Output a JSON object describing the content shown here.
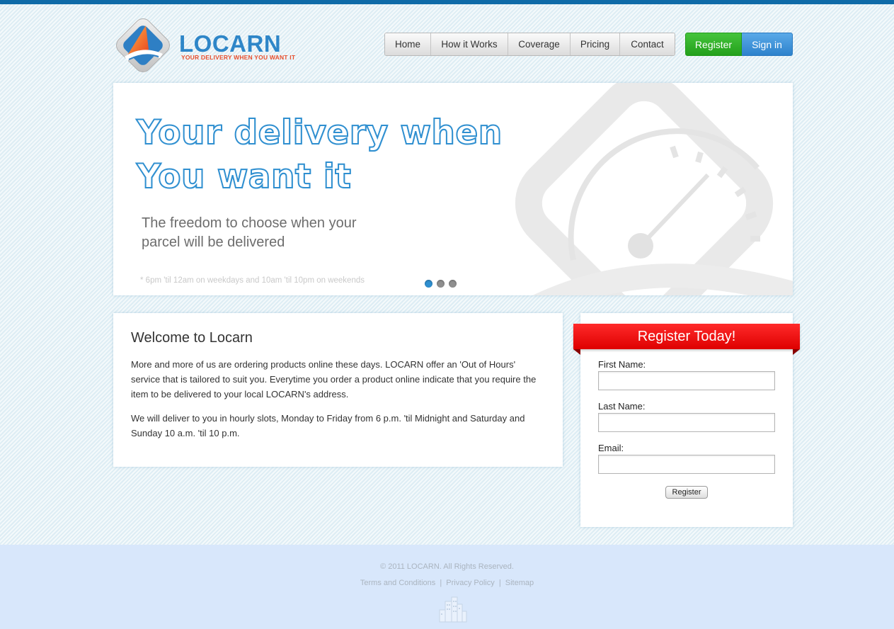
{
  "brand": {
    "name": "LOCARN",
    "tagline": "YOUR DELIVERY WHEN YOU WANT IT",
    "primary_color": "#2e86c8",
    "accent_color": "#e9502e"
  },
  "nav": {
    "items": [
      {
        "label": "Home"
      },
      {
        "label": "How it Works"
      },
      {
        "label": "Coverage"
      },
      {
        "label": "Pricing"
      },
      {
        "label": "Contact"
      }
    ]
  },
  "auth": {
    "register_label": "Register",
    "signin_label": "Sign in",
    "register_color": "#2fb127",
    "signin_color": "#3a8fd6"
  },
  "hero": {
    "title_line1": "Your delivery when",
    "title_line2": "You want it",
    "subtitle_line1": "The freedom to choose when your",
    "subtitle_line2": "parcel will be delivered",
    "note": "* 6pm 'til 12am on weekdays and 10am 'til 10pm on weekends",
    "slides": 3,
    "active_slide": 1
  },
  "welcome": {
    "heading": "Welcome to Locarn",
    "para1": "More and more of us are ordering products online these days. LOCARN offer an 'Out of Hours' service that is tailored to suit you. Everytime you order a product online indicate that you require the item to be delivered to your local LOCARN's address.",
    "para2": "We will deliver to you in hourly slots, Monday to Friday from 6 p.m. 'til Midnight and Saturday and Sunday 10 a.m. 'til 10 p.m."
  },
  "register_form": {
    "title": "Register Today!",
    "first_name_label": "First Name:",
    "first_name_value": "",
    "last_name_label": "Last Name:",
    "last_name_value": "",
    "email_label": "Email:",
    "email_value": "",
    "submit_label": "Register",
    "ribbon_color": "#ee0000"
  },
  "footer": {
    "copyright": "© 2011 LOCARN. All Rights Reserved.",
    "links": [
      "Terms and Conditions",
      "Privacy Policy",
      "Sitemap"
    ],
    "separator": "|",
    "icon": "city-skyline-icon"
  }
}
